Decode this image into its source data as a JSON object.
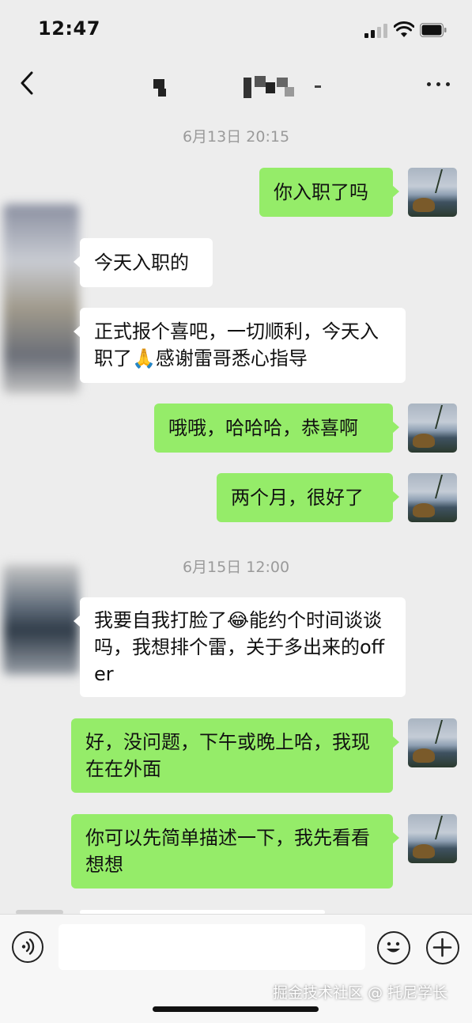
{
  "status_bar": {
    "time": "12:47"
  },
  "nav": {
    "title_redacted": true
  },
  "messages": [
    {
      "type": "timestamp",
      "text": "6月13日 20:15"
    },
    {
      "type": "message",
      "sender": "me",
      "text": "你入职了吗"
    },
    {
      "type": "message",
      "sender": "other",
      "text": "今天入职的"
    },
    {
      "type": "message",
      "sender": "other",
      "text": "正式报个喜吧，一切顺利，今天入职了🙏感谢雷哥悉心指导"
    },
    {
      "type": "message",
      "sender": "me",
      "text": "哦哦，哈哈哈，恭喜啊"
    },
    {
      "type": "message",
      "sender": "me",
      "text": "两个月，很好了"
    },
    {
      "type": "timestamp",
      "text": "6月15日 12:00"
    },
    {
      "type": "message",
      "sender": "other",
      "text": "我要自我打脸了😂能约个时间谈谈吗，我想排个雷，关于多出来的offer"
    },
    {
      "type": "message",
      "sender": "me",
      "text": "好，没问题，下午或晚上哈，我现在在外面"
    },
    {
      "type": "message",
      "sender": "me",
      "text": "你可以先简单描述一下，我先看看想想"
    }
  ],
  "input_bar": {
    "placeholder": "",
    "icons": [
      "voice-icon",
      "emoji-icon",
      "plus-icon"
    ]
  },
  "watermark": "掘金技术社区 @ 托尼学长",
  "icons": {
    "back": "chevron-left-icon",
    "more": "more-dots-icon",
    "signal": "cellular-signal-icon",
    "wifi": "wifi-icon",
    "battery": "battery-icon"
  },
  "colors": {
    "background": "#ededed",
    "outgoing_bubble": "#95ec69",
    "incoming_bubble": "#ffffff",
    "timestamp_text": "#9a9a9a"
  }
}
